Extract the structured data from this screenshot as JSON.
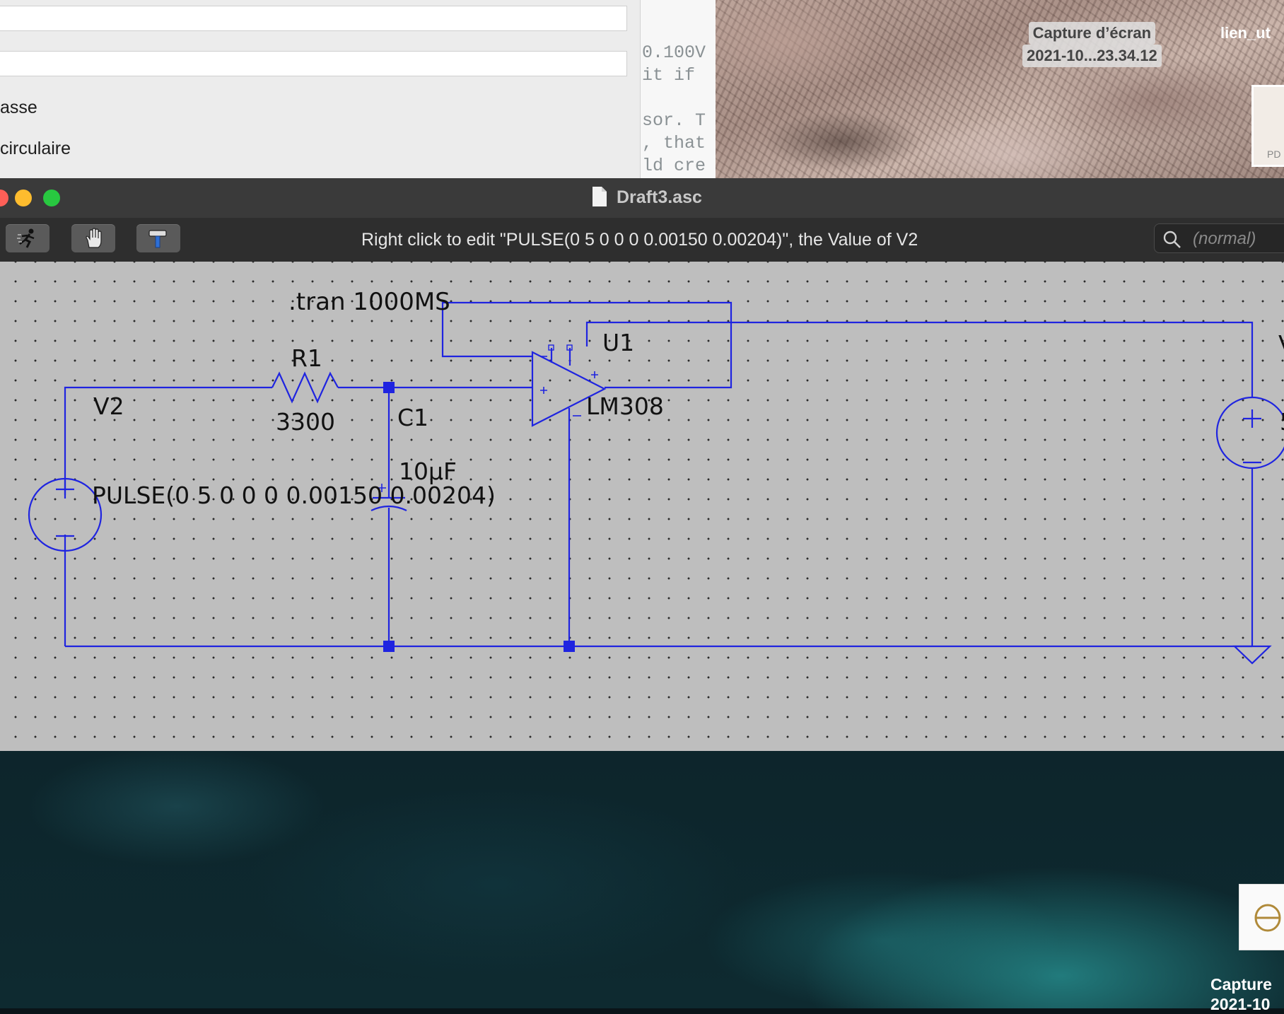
{
  "prefs_window": {
    "labels": [
      "asse",
      "circulaire"
    ]
  },
  "code_window": {
    "lines": [
      "0.100V",
      "it if",
      "",
      "sor. T",
      ", that",
      "ld cre"
    ]
  },
  "desktop": {
    "file_label_line1": "Capture d’écran",
    "file_label_line2": "2021-10...23.34.12",
    "file2_label": "lien_ut",
    "thumb_label": "PD",
    "dock_caption_line1": "Capture",
    "dock_caption_line2": "2021-10"
  },
  "window": {
    "title": "Draft3.asc",
    "status": "Right click to edit \"PULSE(0 5 0 0 0 0.00150 0.00204)\", the Value of V2",
    "search_placeholder": "(normal)"
  },
  "toolbar": {
    "buttons": [
      "run-icon",
      "hand-icon",
      "hammer-icon"
    ]
  },
  "schematic": {
    "directive": ".tran 1000MS",
    "r1_name": "R1",
    "r1_value": "3300",
    "c1_name": "C1",
    "c1_value": "10µF",
    "v2_name": "V2",
    "v2_value": "PULSE(0 5 0 0 0 0.00150 0.00204)",
    "u1_name": "U1",
    "u1_model": "LM308",
    "v1_name_partial": "V",
    "v1_value_partial": "5",
    "wire_color": "#1f24e0"
  },
  "colors": {
    "close": "#fe5f57",
    "minimize": "#febc2e",
    "zoom": "#28c840"
  }
}
